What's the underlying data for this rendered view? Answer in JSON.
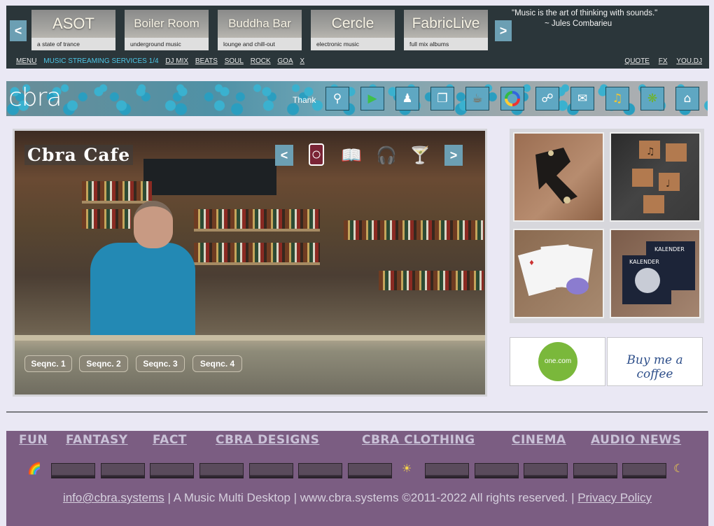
{
  "top_panel": {
    "prev_label": "<",
    "next_label": ">",
    "stations": [
      {
        "title": "ASOT",
        "subtitle": "a state of trance"
      },
      {
        "title": "Boiler Room",
        "subtitle": "underground music"
      },
      {
        "title": "Buddha Bar",
        "subtitle": "lounge and chill-out"
      },
      {
        "title": "Cercle",
        "subtitle": "electronic music"
      },
      {
        "title": "FabricLive",
        "subtitle": "full mix albums"
      }
    ],
    "quote_text": "\"Music is the art of thinking with sounds.\"",
    "quote_author": "~ Jules Combarieu",
    "nav_left": [
      "MENU"
    ],
    "nav_current": "MUSIC STREAMING SERVICES 1/4",
    "nav_items": [
      "DJ MIX",
      "BEATS",
      "SOUL",
      "ROCK",
      "GOA",
      "X"
    ],
    "nav_right": [
      "QUOTE",
      "FX",
      "YOU.DJ"
    ]
  },
  "logo_bar": {
    "logo": "cbra",
    "marquee": "Thank",
    "tools": [
      "search-icon",
      "play-icon",
      "users-icon",
      "documents-icon",
      "coffee-cup-icon",
      "color-wheel-icon",
      "link-icon",
      "chat-icon",
      "music-note-icon",
      "palm-tree-icon",
      "home-icon"
    ]
  },
  "scene": {
    "title": "Cbra Cafe",
    "prev_label": "<",
    "next_label": ">",
    "icons": [
      "card-icon",
      "book-icon",
      "headphones-icon",
      "cocktail-icon"
    ],
    "sequences": [
      "Seqnc. 1",
      "Seqnc. 2",
      "Seqnc. 3",
      "Seqnc. 4"
    ]
  },
  "promos": {
    "onecom": "one.com",
    "coffee": "Buy me a coffee"
  },
  "footer": {
    "links": [
      "FUN",
      "FANTASY",
      "FACT",
      "CBRA DESIGNS",
      "CBRA CLOTHING",
      "CINEMA",
      "AUDIO NEWS"
    ],
    "email": "info@cbra.systems",
    "middle": " | A Music Multi Desktop | www.cbra.systems ©2011-2022 All rights reserved. | ",
    "privacy": "Privacy Policy"
  },
  "colors": {
    "top_panel_bg": "#2b363a",
    "accent_blue": "#6c9fb3",
    "current_nav": "#4dc6e6",
    "footer_bg": "#7b5d82"
  }
}
